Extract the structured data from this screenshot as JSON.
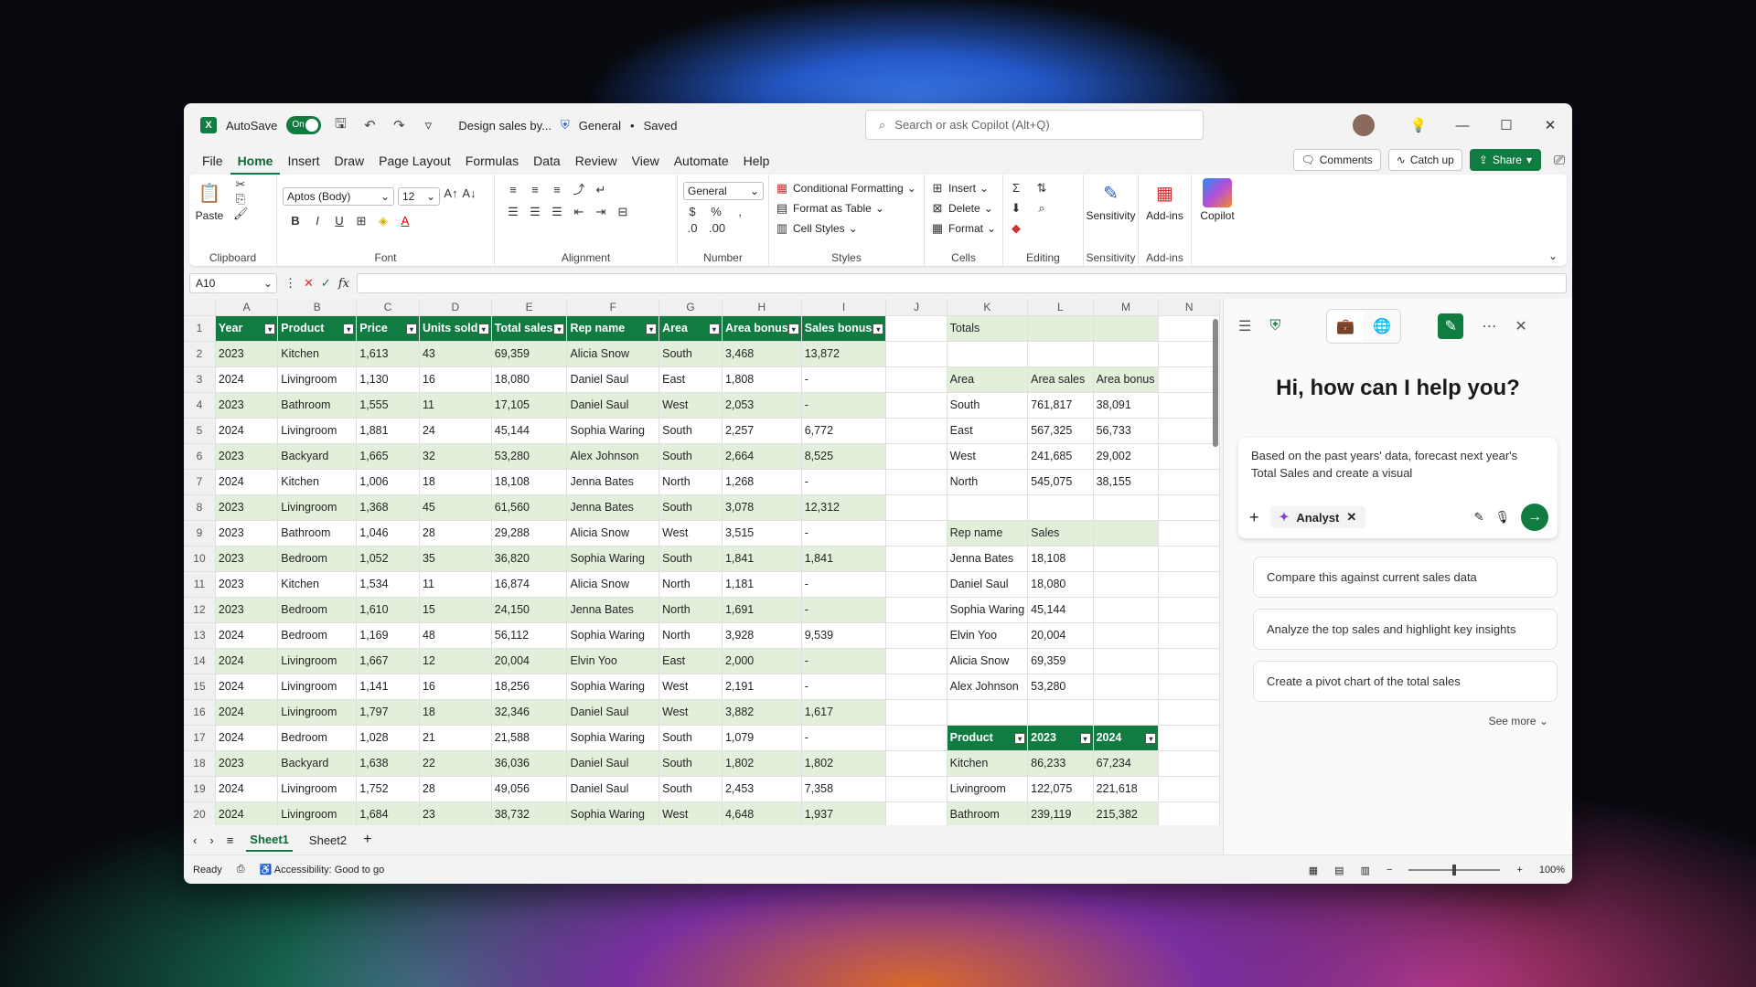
{
  "titlebar": {
    "autosave": "AutoSave",
    "toggle": "On",
    "doc_title": "Design sales by...",
    "sensitivity": "General",
    "saved": "Saved",
    "search_placeholder": "Search or ask Copilot (Alt+Q)"
  },
  "menu": {
    "items": [
      "File",
      "Home",
      "Insert",
      "Draw",
      "Page Layout",
      "Formulas",
      "Data",
      "Review",
      "View",
      "Automate",
      "Help"
    ],
    "comments": "Comments",
    "catchup": "Catch up",
    "share": "Share"
  },
  "ribbon": {
    "paste": "Paste",
    "clipboard": "Clipboard",
    "font_name": "Aptos (Body)",
    "font_size": "12",
    "font": "Font",
    "alignment": "Alignment",
    "number_format": "General",
    "number": "Number",
    "cond_fmt": "Conditional Formatting",
    "fmt_table": "Format as Table",
    "cell_styles": "Cell Styles",
    "styles": "Styles",
    "insert": "Insert",
    "delete": "Delete",
    "format": "Format",
    "cells": "Cells",
    "editing": "Editing",
    "sensitivity": "Sensitivity",
    "sensitivity_label": "Sensitivity",
    "addins": "Add-ins",
    "addins_label": "Add-ins",
    "copilot": "Copilot"
  },
  "formula_bar": {
    "name_box": "A10",
    "fx": "fx"
  },
  "columns": [
    "A",
    "B",
    "C",
    "D",
    "E",
    "F",
    "G",
    "H",
    "I",
    "J",
    "K",
    "L",
    "M",
    "N"
  ],
  "table_headers": [
    "Year",
    "Product",
    "Price",
    "Units sold",
    "Total sales",
    "Rep name",
    "Area",
    "Area bonus",
    "Sales bonus"
  ],
  "rows": [
    [
      "2023",
      "Kitchen",
      "1,613",
      "43",
      "69,359",
      "Alicia Snow",
      "South",
      "3,468",
      "13,872"
    ],
    [
      "2024",
      "Livingroom",
      "1,130",
      "16",
      "18,080",
      "Daniel Saul",
      "East",
      "1,808",
      "-"
    ],
    [
      "2023",
      "Bathroom",
      "1,555",
      "11",
      "17,105",
      "Daniel Saul",
      "West",
      "2,053",
      "-"
    ],
    [
      "2024",
      "Livingroom",
      "1,881",
      "24",
      "45,144",
      "Sophia Waring",
      "South",
      "2,257",
      "6,772"
    ],
    [
      "2023",
      "Backyard",
      "1,665",
      "32",
      "53,280",
      "Alex Johnson",
      "South",
      "2,664",
      "8,525"
    ],
    [
      "2024",
      "Kitchen",
      "1,006",
      "18",
      "18,108",
      "Jenna Bates",
      "North",
      "1,268",
      "-"
    ],
    [
      "2023",
      "Livingroom",
      "1,368",
      "45",
      "61,560",
      "Jenna Bates",
      "South",
      "3,078",
      "12,312"
    ],
    [
      "2023",
      "Bathroom",
      "1,046",
      "28",
      "29,288",
      "Alicia Snow",
      "West",
      "3,515",
      "-"
    ],
    [
      "2023",
      "Bedroom",
      "1,052",
      "35",
      "36,820",
      "Sophia Waring",
      "South",
      "1,841",
      "1,841"
    ],
    [
      "2023",
      "Kitchen",
      "1,534",
      "11",
      "16,874",
      "Alicia Snow",
      "North",
      "1,181",
      "-"
    ],
    [
      "2023",
      "Bedroom",
      "1,610",
      "15",
      "24,150",
      "Jenna Bates",
      "North",
      "1,691",
      "-"
    ],
    [
      "2024",
      "Bedroom",
      "1,169",
      "48",
      "56,112",
      "Sophia Waring",
      "North",
      "3,928",
      "9,539"
    ],
    [
      "2024",
      "Livingroom",
      "1,667",
      "12",
      "20,004",
      "Elvin Yoo",
      "East",
      "2,000",
      "-"
    ],
    [
      "2024",
      "Livingroom",
      "1,141",
      "16",
      "18,256",
      "Sophia Waring",
      "West",
      "2,191",
      "-"
    ],
    [
      "2024",
      "Livingroom",
      "1,797",
      "18",
      "32,346",
      "Daniel Saul",
      "West",
      "3,882",
      "1,617"
    ],
    [
      "2024",
      "Bedroom",
      "1,028",
      "21",
      "21,588",
      "Sophia Waring",
      "South",
      "1,079",
      "-"
    ],
    [
      "2023",
      "Backyard",
      "1,638",
      "22",
      "36,036",
      "Daniel Saul",
      "South",
      "1,802",
      "1,802"
    ],
    [
      "2024",
      "Livingroom",
      "1,752",
      "28",
      "49,056",
      "Daniel Saul",
      "South",
      "2,453",
      "7,358"
    ],
    [
      "2024",
      "Livingroom",
      "1,684",
      "23",
      "38,732",
      "Sophia Waring",
      "West",
      "4,648",
      "1,937"
    ]
  ],
  "side": [
    [
      "Totals",
      "",
      ""
    ],
    [
      "",
      "",
      ""
    ],
    [
      "Area",
      "Area sales",
      "Area bonus"
    ],
    [
      "South",
      "761,817",
      "38,091"
    ],
    [
      "East",
      "567,325",
      "56,733"
    ],
    [
      "West",
      "241,685",
      "29,002"
    ],
    [
      "North",
      "545,075",
      "38,155"
    ],
    [
      "",
      "",
      ""
    ],
    [
      "Rep name",
      "Sales",
      ""
    ],
    [
      "Jenna Bates",
      "18,108",
      ""
    ],
    [
      "Daniel Saul",
      "18,080",
      ""
    ],
    [
      "Sophia Waring",
      "45,144",
      ""
    ],
    [
      "Elvin Yoo",
      "20,004",
      ""
    ],
    [
      "Alicia Snow",
      "69,359",
      ""
    ],
    [
      "Alex Johnson",
      "53,280",
      ""
    ],
    [
      "",
      "",
      ""
    ],
    [
      "Product",
      "2023",
      "2024"
    ],
    [
      "Kitchen",
      "86,233",
      "67,234"
    ],
    [
      "Livingroom",
      "122,075",
      "221,618"
    ],
    [
      "Bathroom",
      "239,119",
      "215,382"
    ]
  ],
  "sheets": [
    "Sheet1",
    "Sheet2"
  ],
  "status": {
    "ready": "Ready",
    "accessibility": "Accessibility: Good to go",
    "zoom": "100%"
  },
  "copilot": {
    "greeting": "Hi, how can I help you?",
    "prompt": "Based on the past years' data, forecast next year's Total Sales and create a visual",
    "chip": "Analyst",
    "suggestions": [
      "Compare this against current sales data",
      "Analyze the top sales and highlight key insights",
      "Create a pivot chart of the total sales"
    ],
    "see_more": "See more"
  }
}
